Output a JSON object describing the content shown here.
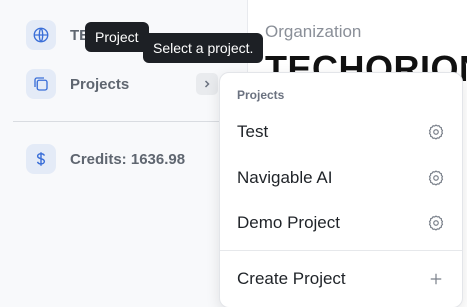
{
  "sidebar": {
    "org_item_label": "TE",
    "projects_label": "Projects",
    "credits_label": "Credits:",
    "credits_value": "1636.98"
  },
  "main": {
    "org_label": "Organization",
    "org_name": "TECHORION"
  },
  "tooltips": {
    "project": "Project",
    "select_project": "Select a project."
  },
  "menu": {
    "header": "Projects",
    "projects": [
      {
        "name": "Test"
      },
      {
        "name": "Navigable AI"
      },
      {
        "name": "Demo Project"
      }
    ],
    "create_label": "Create Project"
  },
  "colors": {
    "accent": "#3b6fd8",
    "tooltip_bg": "#1d2025"
  },
  "icons": [
    "globe-icon",
    "projects-folder-icon",
    "chevron-right-icon",
    "dollar-icon",
    "gear-icon",
    "plus-icon"
  ]
}
